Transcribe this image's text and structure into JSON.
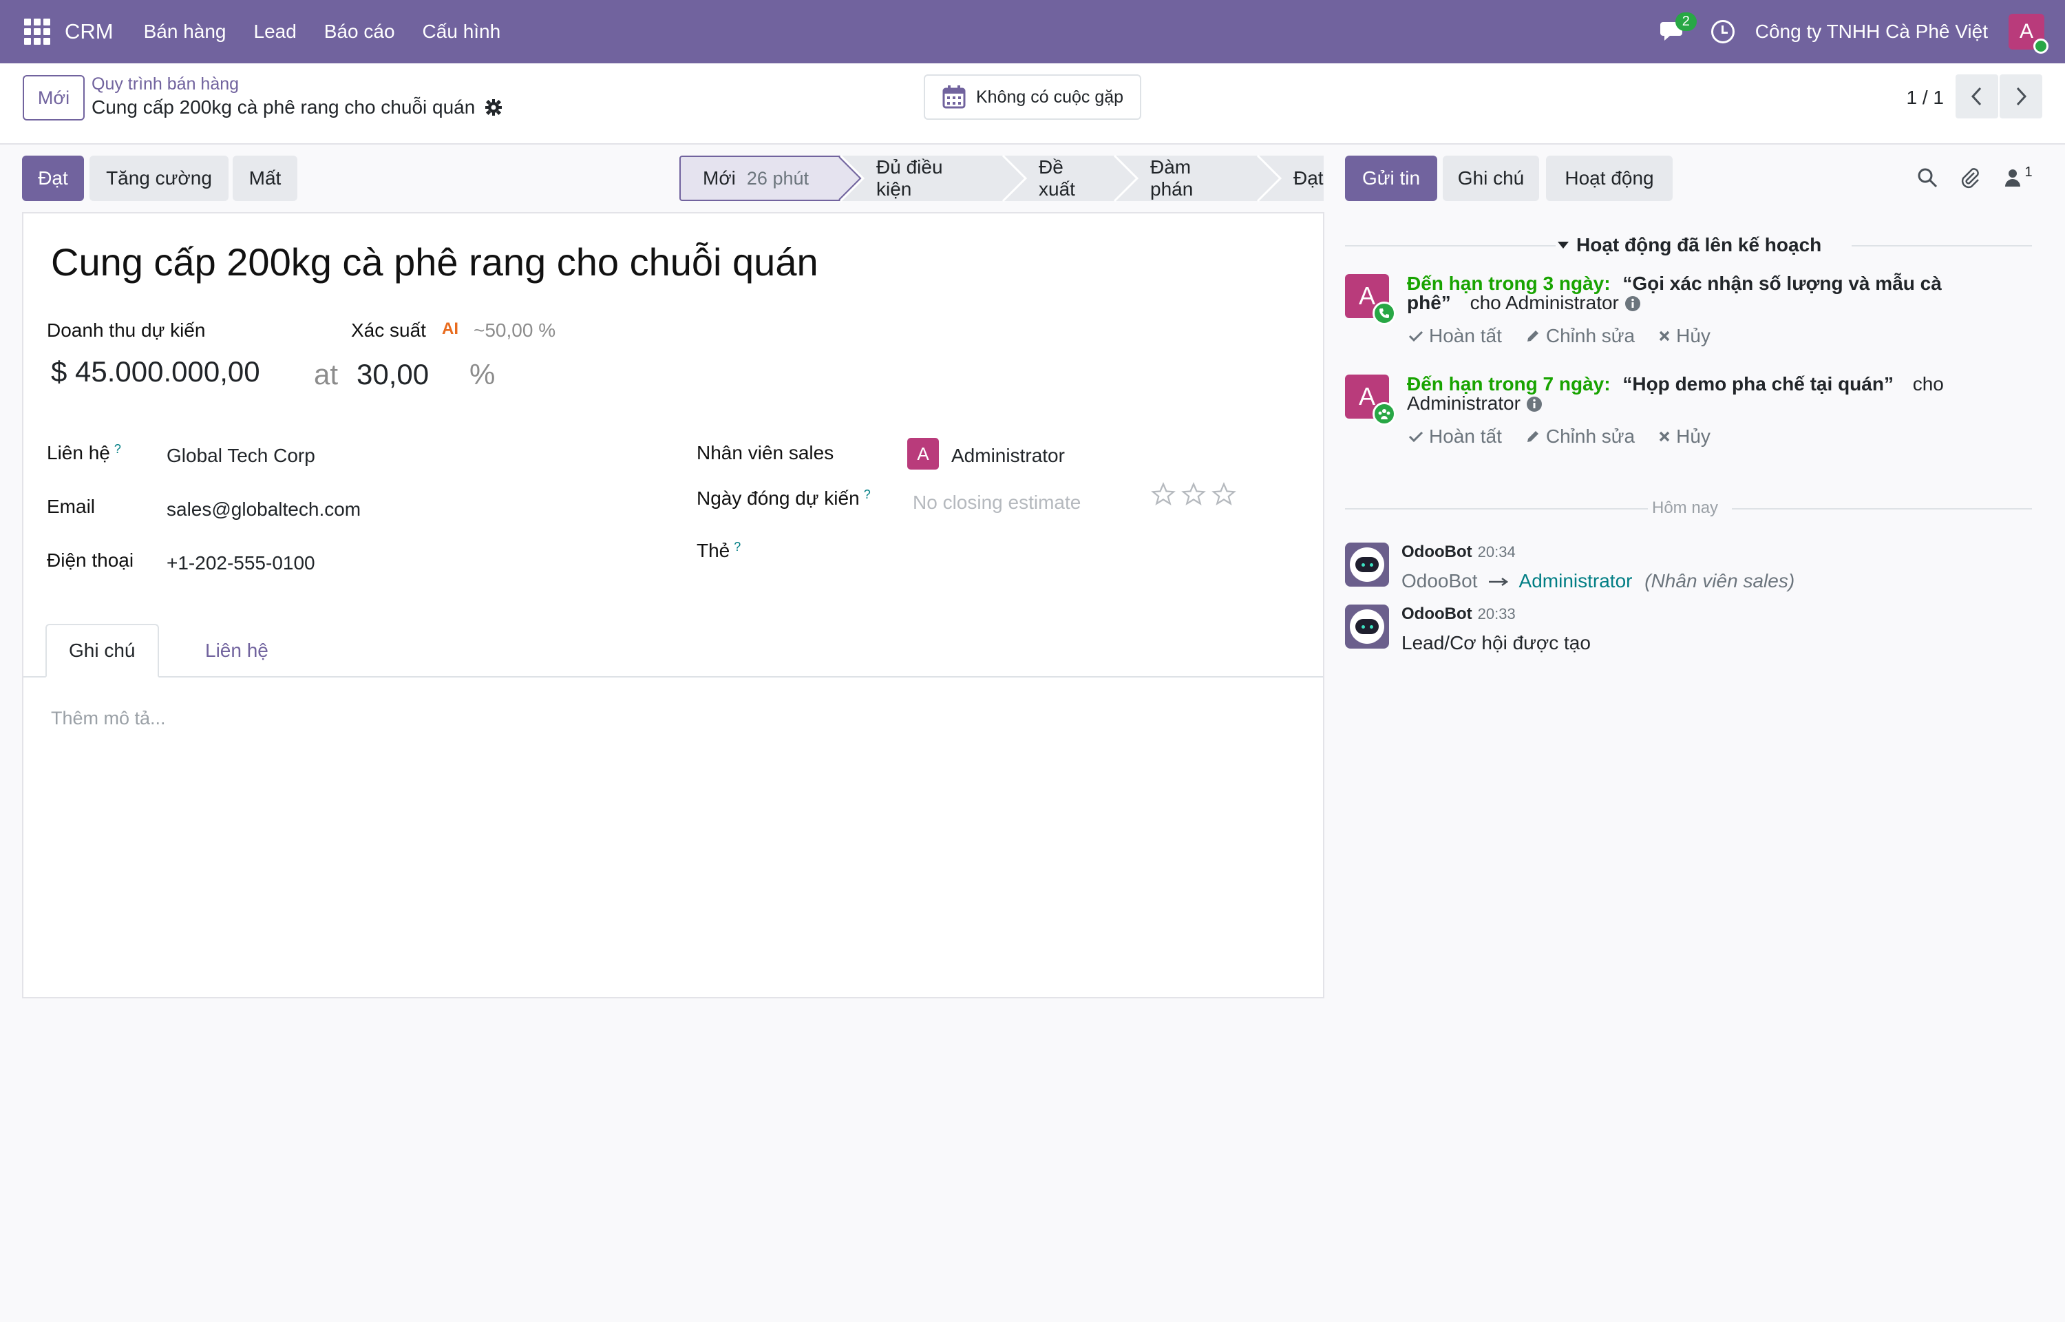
{
  "topnav": {
    "brand": "CRM",
    "menu": [
      "Bán hàng",
      "Lead",
      "Báo cáo",
      "Cấu hình"
    ],
    "chat_badge": "2",
    "company": "Công ty TNHH Cà Phê Việt",
    "user_initial": "A"
  },
  "control": {
    "new_button": "Mới",
    "breadcrumb": "Quy trình bán hàng",
    "record_name": "Cung cấp 200kg cà phê rang cho chuỗi quán",
    "meeting_button": "Không có cuộc gặp",
    "pager": "1 / 1"
  },
  "statusbar": {
    "won_button": "Đạt",
    "enrich_button": "Tăng cường",
    "lost_button": "Mất",
    "stages": [
      "Mới",
      "Đủ điều kiện",
      "Đề xuất",
      "Đàm phán",
      "Đạt"
    ],
    "current_stage_duration": "26 phút"
  },
  "form": {
    "title": "Cung cấp 200kg cà phê rang cho chuỗi quán",
    "revenue_label": "Doanh thu dự kiến",
    "revenue_value": "$ 45.000.000,00",
    "at": "at",
    "probability_label": "Xác suất",
    "ai_label": "AI",
    "ai_probability": "~50,00 %",
    "probability_value": "30,00",
    "percent": "%",
    "contact_label": "Liên hệ",
    "contact_value": "Global Tech Corp",
    "email_label": "Email",
    "email_value": "sales@globaltech.com",
    "phone_label": "Điện thoại",
    "phone_value": "+1-202-555-0100",
    "salesperson_label": "Nhân viên sales",
    "salesperson_initial": "A",
    "salesperson_value": "Administrator",
    "closing_label": "Ngày đóng dự kiến",
    "closing_placeholder": "No closing estimate",
    "tags_label": "Thẻ",
    "help_mark": "?",
    "tabs": [
      "Ghi chú",
      "Liên hệ"
    ],
    "description_placeholder": "Thêm mô tả...",
    "priority_stars": 0
  },
  "chatter": {
    "send_message": "Gửi tin",
    "log_note": "Ghi chú",
    "activities": "Hoạt động",
    "followers_count": "1",
    "planned_header": "Hoạt động đã lên kế hoạch",
    "activities_list": [
      {
        "initial": "A",
        "due": "Đến hạn trong 3 ngày:",
        "title_line1": "“Gọi xác nhận số lượng và mẫu cà",
        "title_line2": "phê”",
        "assignee": "cho Administrator"
      },
      {
        "initial": "A",
        "due": "Đến hạn trong 7 ngày:",
        "title_line1": "“Họp demo pha chế tại quán”",
        "assignee_part1": "cho",
        "assignee_part2": "Administrator"
      }
    ],
    "activity_actions": [
      "Hoàn tất",
      "Chỉnh sửa",
      "Hủy"
    ],
    "today": "Hôm nay",
    "messages": [
      {
        "author": "OdooBot",
        "time": "20:34",
        "old_value": "OdooBot",
        "new_value": "Administrator",
        "field": "(Nhân viên sales)"
      },
      {
        "author": "OdooBot",
        "time": "20:33",
        "body": "Lead/Cơ hội được tạo"
      }
    ]
  },
  "colors": {
    "brand": "#71639e",
    "success": "#18a300",
    "avatar": "#b93b7b",
    "link": "#017e84"
  }
}
